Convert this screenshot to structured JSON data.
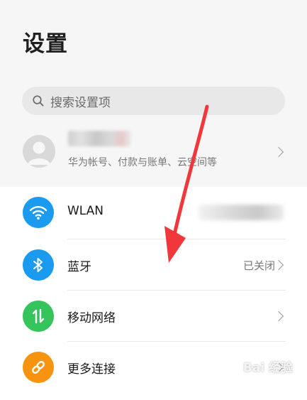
{
  "header": {
    "title": "设置"
  },
  "search": {
    "placeholder": "搜索设置项"
  },
  "account": {
    "subtitle": "华为帐号、付款与账单、云空间等"
  },
  "settings": {
    "items": [
      {
        "label": "WLAN",
        "value": "",
        "icon": "wifi-icon",
        "color": "#1a9bf0"
      },
      {
        "label": "蓝牙",
        "value": "已关闭",
        "icon": "bluetooth-icon",
        "color": "#1a9bf0"
      },
      {
        "label": "移动网络",
        "value": "",
        "icon": "mobile-data-icon",
        "color": "#35c45b"
      },
      {
        "label": "更多连接",
        "value": "",
        "icon": "link-icon",
        "color": "#f7940f"
      }
    ]
  },
  "annotation": {
    "arrow_color": "#f0383c"
  },
  "watermark": {
    "text": "Bai 经验"
  }
}
